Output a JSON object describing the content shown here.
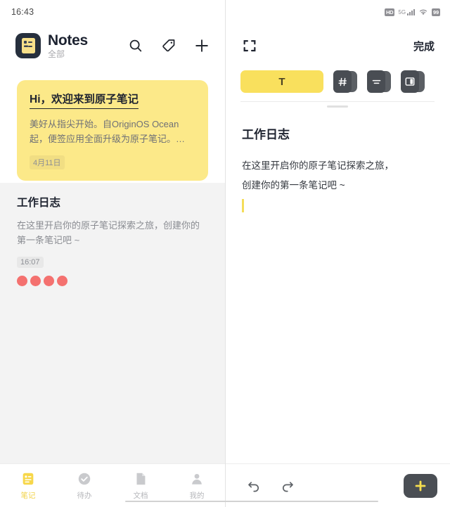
{
  "status_bar": {
    "time": "16:43",
    "hd_label": "HD",
    "network_label": "5G",
    "battery_label": "99"
  },
  "colors": {
    "accent_yellow": "#f9e05d",
    "card_yellow": "#fce989",
    "logo_navy": "#262f3d",
    "dot_red": "#f4716f",
    "icon_dark": "#494d53",
    "list_bg": "#f3f3f3"
  },
  "left_pane": {
    "app_title": "Notes",
    "app_subtitle": "全部",
    "logo_icon": "note-sheet-icon",
    "actions": [
      {
        "name": "search-icon",
        "label": "搜索"
      },
      {
        "name": "tag-icon",
        "label": "标签"
      },
      {
        "name": "add-icon",
        "label": "新建"
      }
    ],
    "notes": [
      {
        "title": "Hi，欢迎来到原子笔记",
        "body": "美好从指尖开始。自OriginOS Ocean起，便签应用全面升级为原子笔记。…",
        "meta": "4月11日",
        "highlighted": true,
        "title_underlined": true,
        "dots": 0
      },
      {
        "title": "工作日志",
        "body": "在这里开启你的原子笔记探索之旅，创建你的第一条笔记吧 ~",
        "meta": "16:07",
        "highlighted": false,
        "title_underlined": false,
        "dots": 4
      }
    ],
    "bottom_nav": [
      {
        "label": "笔记",
        "icon": "notes-icon",
        "active": true
      },
      {
        "label": "待办",
        "icon": "check-circle-icon",
        "active": false
      },
      {
        "label": "文档",
        "icon": "document-icon",
        "active": false
      },
      {
        "label": "我的",
        "icon": "person-icon",
        "active": false
      }
    ]
  },
  "right_pane": {
    "expand_icon": "fullscreen-icon",
    "done_label": "完成",
    "format_bar": [
      {
        "name": "text-format-button",
        "label": "T",
        "active": true
      },
      {
        "name": "heading-hash-button",
        "label": "#",
        "active": false
      },
      {
        "name": "list-lines-button",
        "label": "≡",
        "active": false
      },
      {
        "name": "layout-columns-button",
        "label": "▥",
        "active": false
      }
    ],
    "editor": {
      "title": "工作日志",
      "paragraph_line1": "在这里开启你的原子笔记探索之旅，",
      "paragraph_line2": "创建你的第一条笔记吧 ~"
    },
    "footer": {
      "undo_icon": "undo-icon",
      "redo_icon": "redo-icon",
      "add_label": "+",
      "add_icon": "plus-icon"
    }
  }
}
